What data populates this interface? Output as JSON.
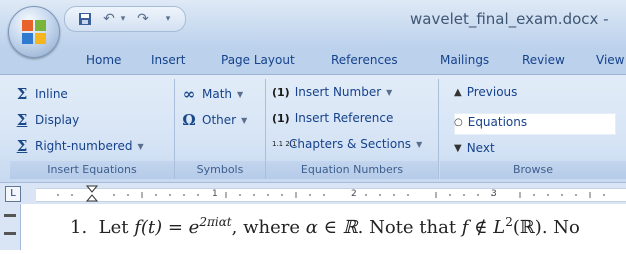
{
  "window": {
    "title": "wavelet_final_exam.docx -"
  },
  "quick_access": {
    "save_icon": "save-icon",
    "undo_icon": "undo-icon",
    "undo_arrow": "▾",
    "redo_icon": "redo-icon",
    "customize_icon": "▾"
  },
  "tabs": [
    "Home",
    "Insert",
    "Page Layout",
    "References",
    "Mailings",
    "Review",
    "View"
  ],
  "ribbon": {
    "insert_equations": {
      "label": "Insert Equations",
      "inline": "Inline",
      "display": "Display",
      "right_numbered": "Right-numbered"
    },
    "symbols": {
      "label": "Symbols",
      "math": "Math",
      "other": "Other"
    },
    "equation_numbers": {
      "label": "Equation Numbers",
      "insert_number_prefix": "(1)",
      "insert_number": "Insert Number",
      "insert_reference_prefix": "(1)",
      "insert_reference": "Insert Reference",
      "chapters_prefix": "1.1 2.1",
      "chapters_sections": "Chapters & Sections"
    },
    "browse": {
      "label": "Browse",
      "previous": "Previous",
      "equations": "Equations",
      "next": "Next"
    }
  },
  "ruler": {
    "tab_selector": "L",
    "numbers": [
      "1",
      "2",
      "3"
    ]
  },
  "document": {
    "line_number": "1.",
    "let": "Let",
    "f_t": "f(t) = e",
    "exponent": "2πiαt",
    "where": ", where",
    "alpha_in_R": "α ∈ ℝ",
    "note_that": ". Note that",
    "f_not_in": "f ∉ L",
    "sup2": "2",
    "paren_R": "(ℝ)",
    "tail": ". No"
  }
}
